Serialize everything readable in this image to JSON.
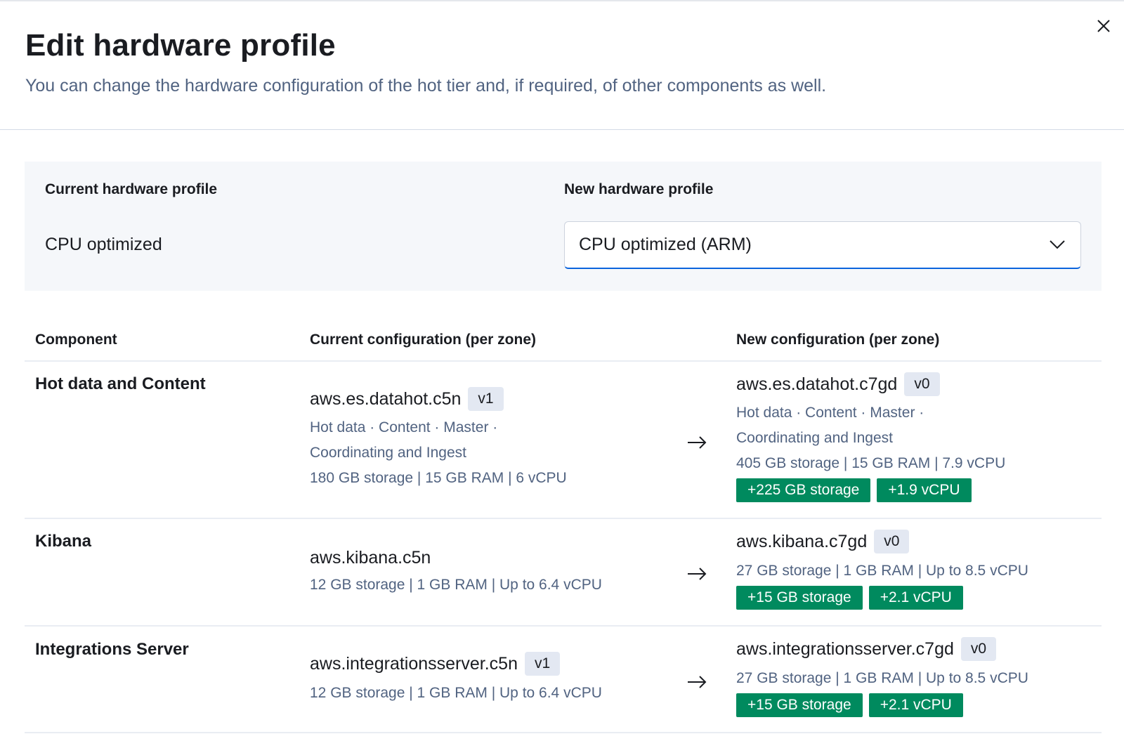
{
  "modal": {
    "title": "Edit hardware profile",
    "subtitle": "You can change the hardware configuration of the hot tier and, if required, of other components as well."
  },
  "profile": {
    "current_label": "Current hardware profile",
    "current_value": "CPU optimized",
    "new_label": "New hardware profile",
    "new_value": "CPU optimized (ARM)"
  },
  "table": {
    "headers": {
      "component": "Component",
      "current": "Current configuration (per zone)",
      "new": "New configuration (per zone)"
    },
    "rows": [
      {
        "component": "Hot data and Content",
        "current": {
          "instance": "aws.es.datahot.c5n",
          "version": "v1",
          "roles_line1": "Hot data · Content · Master ·",
          "roles_line2": "Coordinating and Ingest",
          "specs": "180 GB storage | 15 GB RAM | 6 vCPU"
        },
        "new": {
          "instance": "aws.es.datahot.c7gd",
          "version": "v0",
          "roles_line1": "Hot data · Content · Master ·",
          "roles_line2": "Coordinating and Ingest",
          "specs": "405 GB storage | 15 GB RAM | 7.9 vCPU",
          "changes": [
            "+225 GB storage",
            "+1.9 vCPU"
          ]
        }
      },
      {
        "component": "Kibana",
        "current": {
          "instance": "aws.kibana.c5n",
          "specs": "12 GB storage | 1 GB RAM | Up to 6.4 vCPU"
        },
        "new": {
          "instance": "aws.kibana.c7gd",
          "version": "v0",
          "specs": "27 GB storage | 1 GB RAM | Up to 8.5 vCPU",
          "changes": [
            "+15 GB storage",
            "+2.1 vCPU"
          ]
        }
      },
      {
        "component": "Integrations Server",
        "current": {
          "instance": "aws.integrationsserver.c5n",
          "version": "v1",
          "specs": "12 GB storage | 1 GB RAM | Up to 6.4 vCPU"
        },
        "new": {
          "instance": "aws.integrationsserver.c7gd",
          "version": "v0",
          "specs": "27 GB storage | 1 GB RAM | Up to 8.5 vCPU",
          "changes": [
            "+15 GB storage",
            "+2.1 vCPU"
          ]
        }
      }
    ]
  },
  "icons": {
    "close": "close-icon",
    "dropdown": "chevron-down-icon",
    "arrow": "arrow-right-icon"
  },
  "colors": {
    "change_chip": "#008a5e",
    "select_focus": "#0b64dd",
    "muted_text": "#516381"
  }
}
